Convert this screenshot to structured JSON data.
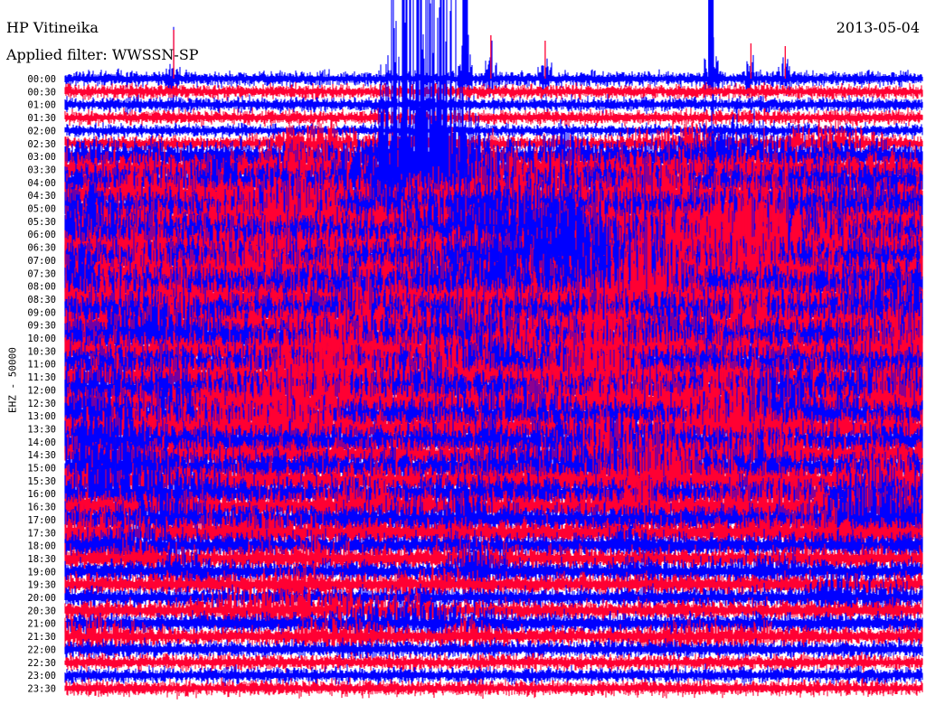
{
  "header": {
    "station": "HP Vitineika",
    "date": "2013-05-04",
    "filter": "Applied filter: WWSSN-SP"
  },
  "colors": {
    "series_a": "#0000ff",
    "series_b": "#ff0033",
    "background": "#ffffff"
  },
  "chart_data": {
    "type": "line",
    "title": "HP Vitineika",
    "date": "2013-05-04",
    "filter": "WWSSN-SP",
    "ylabel": "EHZ - 50000",
    "row_labels": [
      "00:00",
      "00:30",
      "01:00",
      "01:30",
      "02:00",
      "02:30",
      "03:00",
      "03:30",
      "04:00",
      "04:30",
      "05:00",
      "05:30",
      "06:00",
      "06:30",
      "07:00",
      "07:30",
      "08:00",
      "08:30",
      "09:00",
      "09:30",
      "10:00",
      "10:30",
      "11:00",
      "11:30",
      "12:00",
      "12:30",
      "13:00",
      "13:30",
      "14:00",
      "14:30",
      "15:00",
      "15:30",
      "16:00",
      "16:30",
      "17:00",
      "17:30",
      "18:00",
      "18:30",
      "19:00",
      "19:30",
      "20:00",
      "20:30",
      "21:00",
      "21:30",
      "22:00",
      "22:30",
      "23:00",
      "23:30"
    ],
    "row_amplitude": [
      0.9,
      0.9,
      0.9,
      0.9,
      0.8,
      1.0,
      2.0,
      2.4,
      2.6,
      2.6,
      2.8,
      3.0,
      3.0,
      3.0,
      3.0,
      3.0,
      3.0,
      3.0,
      2.8,
      2.8,
      2.8,
      2.6,
      2.6,
      2.6,
      2.6,
      2.5,
      2.4,
      2.4,
      2.3,
      2.2,
      2.2,
      2.2,
      2.1,
      2.0,
      2.0,
      1.8,
      1.6,
      1.5,
      1.4,
      1.4,
      1.3,
      1.3,
      1.3,
      1.2,
      1.1,
      1.0,
      1.0,
      1.0
    ],
    "events": [
      {
        "row": 0,
        "minute": 14.0,
        "strength": 3.2
      },
      {
        "row": 0,
        "minute": 22.6,
        "strength": 4.0
      },
      {
        "row": 0,
        "minute": 3.8,
        "strength": 1.8
      },
      {
        "row": 0,
        "minute": 14.9,
        "strength": 1.6
      },
      {
        "row": 0,
        "minute": 16.8,
        "strength": 1.4
      },
      {
        "row": 0,
        "minute": 24.0,
        "strength": 1.3
      },
      {
        "row": 0,
        "minute": 25.2,
        "strength": 1.2
      }
    ],
    "grid": false,
    "legend": "none"
  }
}
